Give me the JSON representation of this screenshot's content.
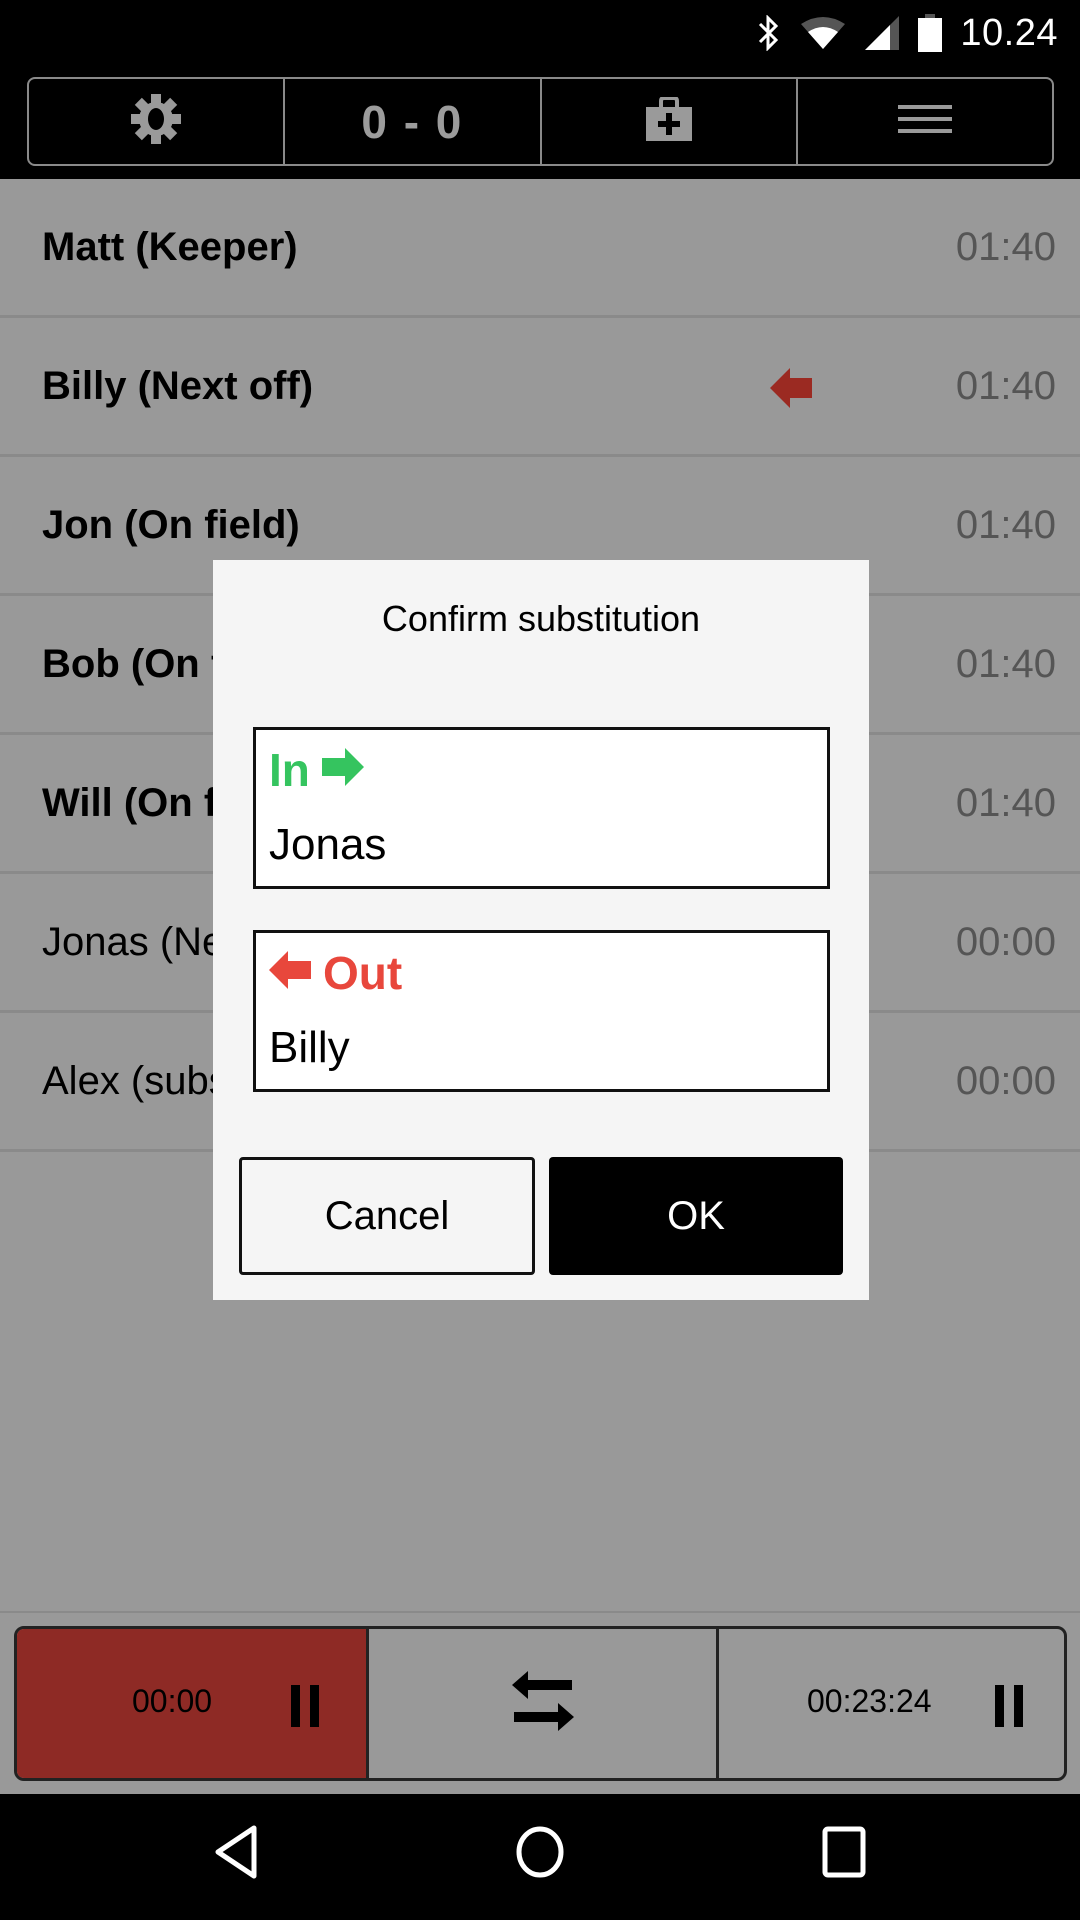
{
  "status_bar": {
    "time": "10.24",
    "icons": [
      "bluetooth-icon",
      "wifi-icon",
      "cell-signal-icon",
      "battery-icon"
    ]
  },
  "toolbar": {
    "settings_icon": "gear-icon",
    "score": "0 - 0",
    "injury_icon": "first-aid-kit-icon",
    "menu_icon": "hamburger-menu-icon"
  },
  "players": [
    {
      "label": "Matt (Keeper)",
      "time": "01:40",
      "bold": true,
      "marker": ""
    },
    {
      "label": "Billy (Next off)",
      "time": "01:40",
      "bold": true,
      "marker": "arrow-left-icon"
    },
    {
      "label": "Jon (On field)",
      "time": "01:40",
      "bold": true,
      "marker": ""
    },
    {
      "label": "Bob (On field)",
      "time": "01:40",
      "bold": true,
      "marker": ""
    },
    {
      "label": "Will (On field)",
      "time": "01:40",
      "bold": true,
      "marker": ""
    },
    {
      "label": "Jonas (Next on)",
      "time": "00:00",
      "bold": false,
      "marker": ""
    },
    {
      "label": "Alex (substitute)",
      "time": "00:00",
      "bold": false,
      "marker": ""
    }
  ],
  "colors": {
    "in_green": "#35c45f",
    "out_red": "#e8473c",
    "next_off_arrow": "#9b2a22",
    "period_timer_bg": "#8e2a25",
    "overlay_bg": "#999999",
    "dialog_bg": "#f5f5f5"
  },
  "dialog": {
    "title": "Confirm substitution",
    "in_label": "In",
    "in_player": "Jonas",
    "out_label": "Out",
    "out_player": "Billy",
    "cancel_label": "Cancel",
    "ok_label": "OK"
  },
  "bottom_bar": {
    "player_timer": "00:00",
    "substitute_icon": "swap-arrows-icon",
    "match_timer": "00:23:24"
  },
  "nav_bar": {
    "back": "back-icon",
    "home": "home-icon",
    "recents": "recents-icon"
  }
}
